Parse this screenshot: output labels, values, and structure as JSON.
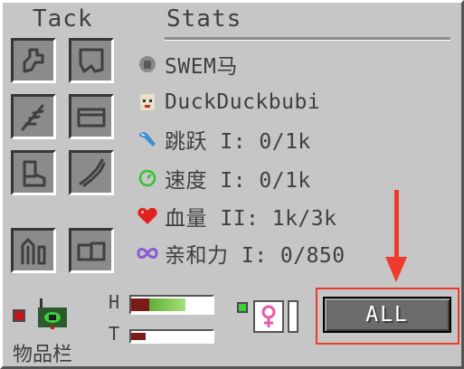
{
  "tack": {
    "title": "Tack"
  },
  "stats": {
    "title": "Stats",
    "rows": [
      {
        "icon": "horse-head-icon",
        "text": "SWEM马"
      },
      {
        "icon": "player-head-icon",
        "text": "DuckDuckbubi"
      },
      {
        "icon": "wrench-icon",
        "text": "跳跃 I: 0/1k"
      },
      {
        "icon": "speed-clock-icon",
        "text": "速度 I: 0/1k"
      },
      {
        "icon": "heart-icon",
        "text": "血量 II: 1k/3k"
      },
      {
        "icon": "infinity-icon",
        "text": "亲和力 I: 0/850"
      }
    ]
  },
  "bars": {
    "h_label": "H",
    "t_label": "T"
  },
  "buttons": {
    "all": "ALL"
  },
  "inventory": {
    "label": "物品栏"
  },
  "colors": {
    "highlight": "#ef3b2c",
    "heart": "#e0221c",
    "speed": "#2ec52e",
    "wrench": "#3a8fd6",
    "infinity": "#8c5ad6"
  }
}
